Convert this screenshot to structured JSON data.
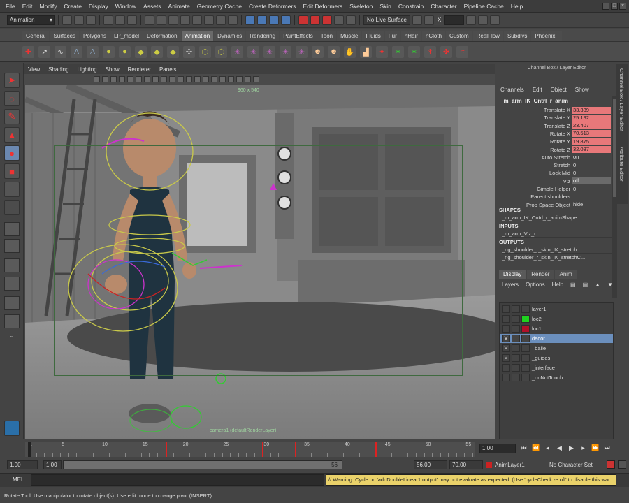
{
  "menubar": [
    "File",
    "Edit",
    "Modify",
    "Create",
    "Display",
    "Window",
    "Assets",
    "Animate",
    "Geometry Cache",
    "Create Deformers",
    "Edit Deformers",
    "Skeleton",
    "Skin",
    "Constrain",
    "Character",
    "Pipeline Cache",
    "Help"
  ],
  "statusline": {
    "mode": "Animation",
    "live_surface": "No Live Surface",
    "x_label": "X:"
  },
  "shelf_tabs": [
    "General",
    "Surfaces",
    "Polygons",
    "LP_model",
    "Deformation",
    "Animation",
    "Dynamics",
    "Rendering",
    "PaintEffects",
    "Toon",
    "Muscle",
    "Fluids",
    "Fur",
    "nHair",
    "nCloth",
    "Custom",
    "RealFlow",
    "Subdivs",
    "PhoenixF"
  ],
  "shelf_active": "Animation",
  "viewport": {
    "menus": [
      "View",
      "Shading",
      "Lighting",
      "Show",
      "Renderer",
      "Panels"
    ],
    "resolution": "960 x 540",
    "camera": "camera1 (defaultRenderLayer)"
  },
  "channel_box": {
    "title": "Channel Box / Layer Editor",
    "menus": [
      "Channels",
      "Edit",
      "Object",
      "Show"
    ],
    "node": "_m_arm_IK_Cntrl_r_anim",
    "channels": [
      {
        "name": "Translate X",
        "value": "33.339"
      },
      {
        "name": "Translate Y",
        "value": "25.192"
      },
      {
        "name": "Translate Z",
        "value": "23.407"
      },
      {
        "name": "Rotate X",
        "value": "70.513"
      },
      {
        "name": "Rotate Y",
        "value": "19.875"
      },
      {
        "name": "Rotate Z",
        "value": "32.087"
      },
      {
        "name": "Auto Stretch",
        "value": "on"
      },
      {
        "name": "Stretch",
        "value": "0"
      },
      {
        "name": "Lock Mid",
        "value": "0"
      },
      {
        "name": "Viz",
        "value": "off"
      },
      {
        "name": "Gimble Helper",
        "value": "0"
      },
      {
        "name": "Parent shoulders",
        "value": ""
      },
      {
        "name": "Prop Space Object",
        "value": "hide"
      }
    ],
    "shapes_label": "SHAPES",
    "shape": "_m_arm_IK_Cntrl_r_animShape",
    "inputs_label": "INPUTS",
    "input": "_m_arm_Viz_r",
    "outputs_label": "OUTPUTS",
    "outputs": [
      "_rig_shoulder_r_skin_IK_stretch...",
      "_rig_shoulder_r_skin_IK_stretchC..."
    ]
  },
  "side_tabs": [
    "Channel Box / Layer Editor",
    "Attribute Editor"
  ],
  "layer_editor": {
    "tabs": [
      "Display",
      "Render",
      "Anim"
    ],
    "active_tab": "Display",
    "menus": [
      "Layers",
      "Options",
      "Help"
    ],
    "layers": [
      {
        "name": "layer1",
        "visible": "",
        "color": "#444444",
        "selected": false
      },
      {
        "name": "loc2",
        "visible": "",
        "color": "#1fd11f",
        "selected": false
      },
      {
        "name": "loc1",
        "visible": "",
        "color": "#b0102a",
        "selected": false
      },
      {
        "name": "decor",
        "visible": "V",
        "color": "#444444",
        "selected": true
      },
      {
        "name": "_balle",
        "visible": "V",
        "color": "#444444",
        "selected": false
      },
      {
        "name": "_guides",
        "visible": "V",
        "color": "#444444",
        "selected": false
      },
      {
        "name": "_interface",
        "visible": "",
        "color": "#444444",
        "selected": false
      },
      {
        "name": "_doNotTouch",
        "visible": "",
        "color": "#444444",
        "selected": false
      }
    ]
  },
  "timeline": {
    "ticks": [
      "1",
      "5",
      "10",
      "15",
      "20",
      "25",
      "30",
      "35",
      "40",
      "45",
      "50",
      "55"
    ],
    "current_frame": "1.00",
    "start_range": "1.00",
    "start_time": "1.00",
    "range_end_display": "56",
    "end_range": "56.00",
    "end_time": "70.00",
    "anim_layer": "AnimLayer1",
    "character_set": "No Character Set"
  },
  "command_line": {
    "label": "MEL",
    "output": "// Warning: Cycle on 'addDoubleLinear1.output' may not evaluate as expected.  (Use 'cycleCheck -e off' to disable this war"
  },
  "help_line": "Rotate Tool: Use manipulator to rotate object(s). Use edit mode to change pivot (INSERT).",
  "colors": {
    "key_red": "#dd2222",
    "warning_bg": "#ead26a",
    "selection": "#6b8fbd",
    "channel_keyed": "#e8787a"
  }
}
